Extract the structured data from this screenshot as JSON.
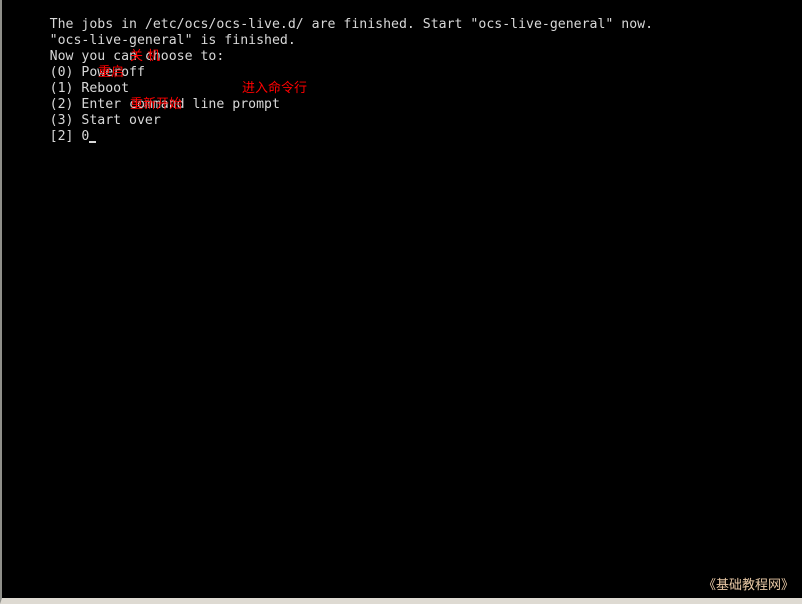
{
  "terminal": {
    "background_color": "#000000",
    "foreground_color": "#d8d8d8",
    "annotation_color": "#ff0000",
    "watermark_color": "#e9c9a6",
    "lines": [
      {
        "text": "The jobs in /etc/ocs/ocs-live.d/ are finished. Start \"ocs-live-general\" now."
      },
      {
        "text": "\"ocs-live-general\" is finished."
      },
      {
        "text": "Now you can choose to:"
      },
      {
        "text": "(0) Poweroff",
        "annotation": "关 机"
      },
      {
        "text": "(1) Reboot",
        "annotation": "重启"
      },
      {
        "text": "(2) Enter command line prompt",
        "annotation": "进入命令行"
      },
      {
        "text": "(3) Start over",
        "annotation": "重新开始"
      }
    ],
    "prompt": {
      "job_marker": "[2]",
      "input": "0"
    },
    "watermark": "《基础教程网》"
  }
}
